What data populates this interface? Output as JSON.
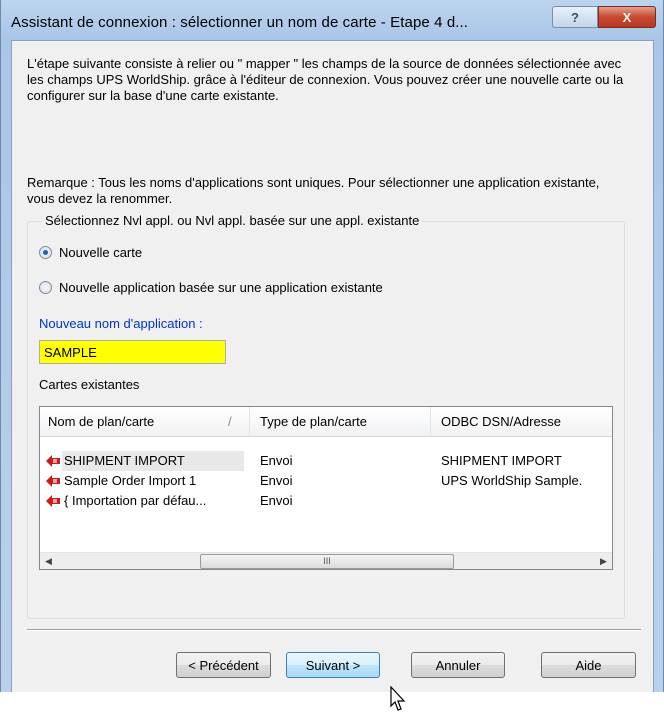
{
  "window": {
    "title": "Assistant de connexion : sélectionner un nom de carte - Etape 4 d...",
    "help_label": "?",
    "close_label": "X"
  },
  "intro_text": "L'étape suivante consiste à relier ou \" mapper \" les champs de la source de données sélectionnée avec les champs UPS WorldShip. grâce à l'éditeur de connexion. Vous pouvez créer une nouvelle carte ou la configurer sur la base d'une carte existante.",
  "remark_text": "Remarque : Tous les noms d'applications sont uniques. Pour sélectionner une application existante, vous devez la renommer.",
  "group": {
    "legend": "Sélectionnez Nvl appl. ou Nvl appl. basée sur une appl. existante",
    "radio_new_map": "Nouvelle carte",
    "radio_based_on_existing": "Nouvelle application basée sur une application existante",
    "selected_option": "Nouvelle carte",
    "new_name_label": "Nouveau nom d'application :",
    "new_name_value": "SAMPLE",
    "existing_maps_label": "Cartes existantes"
  },
  "maps_table": {
    "columns": [
      "Nom de plan/carte",
      "Type de plan/carte",
      "ODBC DSN/Adresse"
    ],
    "sort_glyph": "/",
    "rows": [
      {
        "name": "SHIPMENT IMPORT",
        "type": "Envoi",
        "dsn": "SHIPMENT IMPORT"
      },
      {
        "name": "Sample Order Import 1",
        "type": "Envoi",
        "dsn": "UPS WorldShip Sample."
      },
      {
        "name": "{ Importation par défau...",
        "type": "Envoi",
        "dsn": ""
      }
    ],
    "scroll_left": "◀",
    "scroll_right": "▶",
    "scroll_grip": "III"
  },
  "buttons": {
    "previous": "< Précédent",
    "next": "Suivant >",
    "cancel": "Annuler",
    "help": "Aide"
  },
  "colors": {
    "name_input_bg": "#ffff00",
    "link_label": "#0033cc",
    "close_red": "#c8492f"
  },
  "icons": {
    "row_icon": "map-arrow-icon",
    "cursor": "mouse-pointer-icon"
  }
}
